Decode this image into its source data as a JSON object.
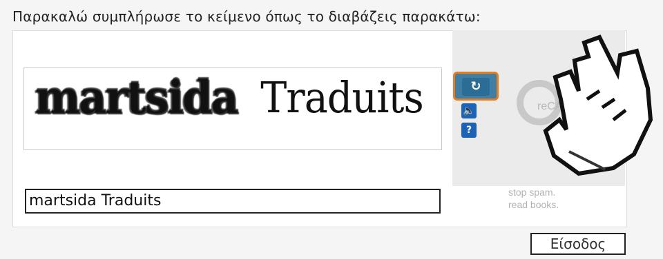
{
  "prompt": "Παρακαλώ συμπλήρωσε το κείμενο όπως το διαβάζεις παρακάτω:",
  "captcha": {
    "word1": "martsida",
    "word2": "Traduits"
  },
  "controls": {
    "refresh_icon": "refresh-icon",
    "audio_icon": "audio-icon",
    "help_icon": "help-icon",
    "highlight_color": "#e57e20"
  },
  "branding": {
    "logo_text": "reCAPTCHA™",
    "tagline_line1": "stop spam.",
    "tagline_line2": "read books."
  },
  "answer": {
    "value": "martsida Traduits"
  },
  "submit": {
    "label": "Είσοδος"
  },
  "pointer": {
    "icon": "hand-pointer-icon"
  }
}
